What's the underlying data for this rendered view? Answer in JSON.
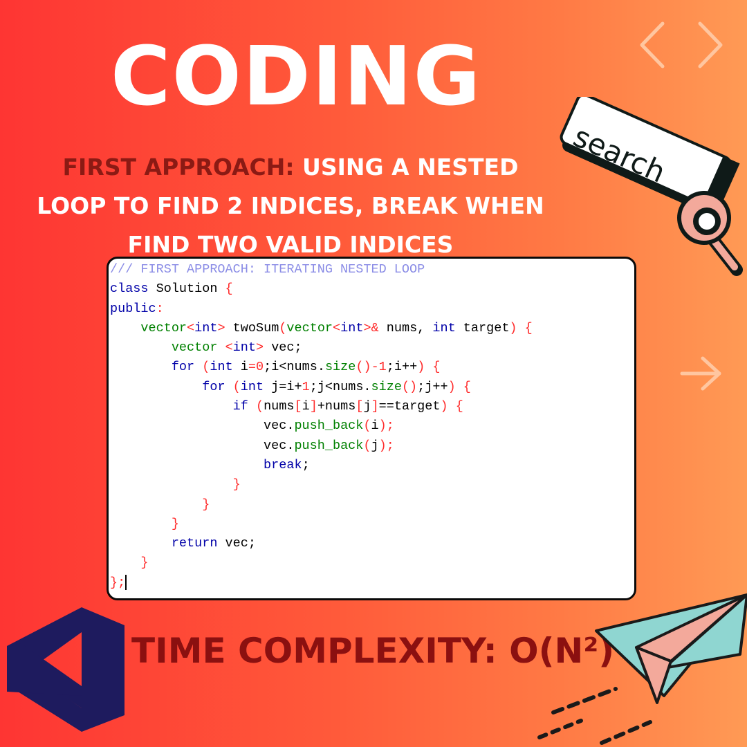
{
  "title": "CODING",
  "heading": {
    "lead": "FIRST APPROACH:",
    "rest_line1": " USING A NESTED",
    "line2": "LOOP TO FIND 2 INDICES, BREAK WHEN",
    "line3": "FIND TWO VALID INDICES"
  },
  "search_bar": {
    "label": "search"
  },
  "code_lines": [
    [
      {
        "t": "/// FIRST APPROACH: ITERATING NESTED LOOP",
        "c": "comment"
      }
    ],
    [
      {
        "t": "class",
        "c": "kw"
      },
      {
        "t": " Solution ",
        "c": "plain"
      },
      {
        "t": "{",
        "c": "punct"
      }
    ],
    [
      {
        "t": "public",
        "c": "kw"
      },
      {
        "t": ":",
        "c": "punct"
      }
    ],
    [
      {
        "t": "    ",
        "c": "plain"
      },
      {
        "t": "vector",
        "c": "type"
      },
      {
        "t": "<",
        "c": "punct"
      },
      {
        "t": "int",
        "c": "kw"
      },
      {
        "t": ">",
        "c": "punct"
      },
      {
        "t": " twoSum",
        "c": "plain"
      },
      {
        "t": "(",
        "c": "punct"
      },
      {
        "t": "vector",
        "c": "type"
      },
      {
        "t": "<",
        "c": "punct"
      },
      {
        "t": "int",
        "c": "kw"
      },
      {
        "t": ">&",
        "c": "punct"
      },
      {
        "t": " nums, ",
        "c": "plain"
      },
      {
        "t": "int",
        "c": "kw"
      },
      {
        "t": " target",
        "c": "plain"
      },
      {
        "t": ") {",
        "c": "punct"
      }
    ],
    [
      {
        "t": "        ",
        "c": "plain"
      },
      {
        "t": "vector",
        "c": "type"
      },
      {
        "t": " <",
        "c": "punct"
      },
      {
        "t": "int",
        "c": "kw"
      },
      {
        "t": ">",
        "c": "punct"
      },
      {
        "t": " vec;",
        "c": "plain"
      }
    ],
    [
      {
        "t": "        ",
        "c": "plain"
      },
      {
        "t": "for",
        "c": "kw"
      },
      {
        "t": " (",
        "c": "punct"
      },
      {
        "t": "int",
        "c": "kw"
      },
      {
        "t": " i",
        "c": "plain"
      },
      {
        "t": "=",
        "c": "punct"
      },
      {
        "t": "0",
        "c": "num"
      },
      {
        "t": ";i<nums.",
        "c": "plain"
      },
      {
        "t": "size",
        "c": "fn"
      },
      {
        "t": "()-",
        "c": "punct"
      },
      {
        "t": "1",
        "c": "num"
      },
      {
        "t": ";i++",
        "c": "plain"
      },
      {
        "t": ") {",
        "c": "punct"
      }
    ],
    [
      {
        "t": "            ",
        "c": "plain"
      },
      {
        "t": "for",
        "c": "kw"
      },
      {
        "t": " (",
        "c": "punct"
      },
      {
        "t": "int",
        "c": "kw"
      },
      {
        "t": " j=i+",
        "c": "plain"
      },
      {
        "t": "1",
        "c": "num"
      },
      {
        "t": ";j<nums.",
        "c": "plain"
      },
      {
        "t": "size",
        "c": "fn"
      },
      {
        "t": "()",
        "c": "punct"
      },
      {
        "t": ";j++",
        "c": "plain"
      },
      {
        "t": ") {",
        "c": "punct"
      }
    ],
    [
      {
        "t": "                ",
        "c": "plain"
      },
      {
        "t": "if",
        "c": "kw"
      },
      {
        "t": " (",
        "c": "punct"
      },
      {
        "t": "nums",
        "c": "plain"
      },
      {
        "t": "[",
        "c": "punct"
      },
      {
        "t": "i",
        "c": "plain"
      },
      {
        "t": "]",
        "c": "punct"
      },
      {
        "t": "+nums",
        "c": "plain"
      },
      {
        "t": "[",
        "c": "punct"
      },
      {
        "t": "j",
        "c": "plain"
      },
      {
        "t": "]",
        "c": "punct"
      },
      {
        "t": "==target",
        "c": "plain"
      },
      {
        "t": ") {",
        "c": "punct"
      }
    ],
    [
      {
        "t": "                    vec.",
        "c": "plain"
      },
      {
        "t": "push_back",
        "c": "fn"
      },
      {
        "t": "(",
        "c": "punct"
      },
      {
        "t": "i",
        "c": "plain"
      },
      {
        "t": ");",
        "c": "punct"
      }
    ],
    [
      {
        "t": "                    vec.",
        "c": "plain"
      },
      {
        "t": "push_back",
        "c": "fn"
      },
      {
        "t": "(",
        "c": "punct"
      },
      {
        "t": "j",
        "c": "plain"
      },
      {
        "t": ");",
        "c": "punct"
      }
    ],
    [
      {
        "t": "                    ",
        "c": "plain"
      },
      {
        "t": "break",
        "c": "kw"
      },
      {
        "t": ";",
        "c": "plain"
      }
    ],
    [
      {
        "t": "                ",
        "c": "plain"
      },
      {
        "t": "}",
        "c": "punct"
      }
    ],
    [
      {
        "t": "            ",
        "c": "plain"
      },
      {
        "t": "}",
        "c": "punct"
      }
    ],
    [
      {
        "t": "        ",
        "c": "plain"
      },
      {
        "t": "}",
        "c": "punct"
      }
    ],
    [
      {
        "t": "        ",
        "c": "plain"
      },
      {
        "t": "return",
        "c": "kw"
      },
      {
        "t": " vec;",
        "c": "plain"
      }
    ],
    [
      {
        "t": "    ",
        "c": "plain"
      },
      {
        "t": "}",
        "c": "punct"
      }
    ],
    [
      {
        "t": "};",
        "c": "punct"
      }
    ]
  ],
  "complexity": "TIME COMPLEXITY: O(N²)",
  "icons": {
    "code_brackets": "code-brackets-icon",
    "arrow": "arrow-right-icon",
    "magnifier": "magnifier-icon",
    "visual_studio": "visual-studio-logo-icon",
    "paper_plane": "paper-plane-icon"
  },
  "colors": {
    "background_left": "#fe3533",
    "background_right": "#ff9a55",
    "heading_lead": "#8b1a14",
    "complexity": "#8b1010",
    "logo": "#1e1b5e"
  }
}
